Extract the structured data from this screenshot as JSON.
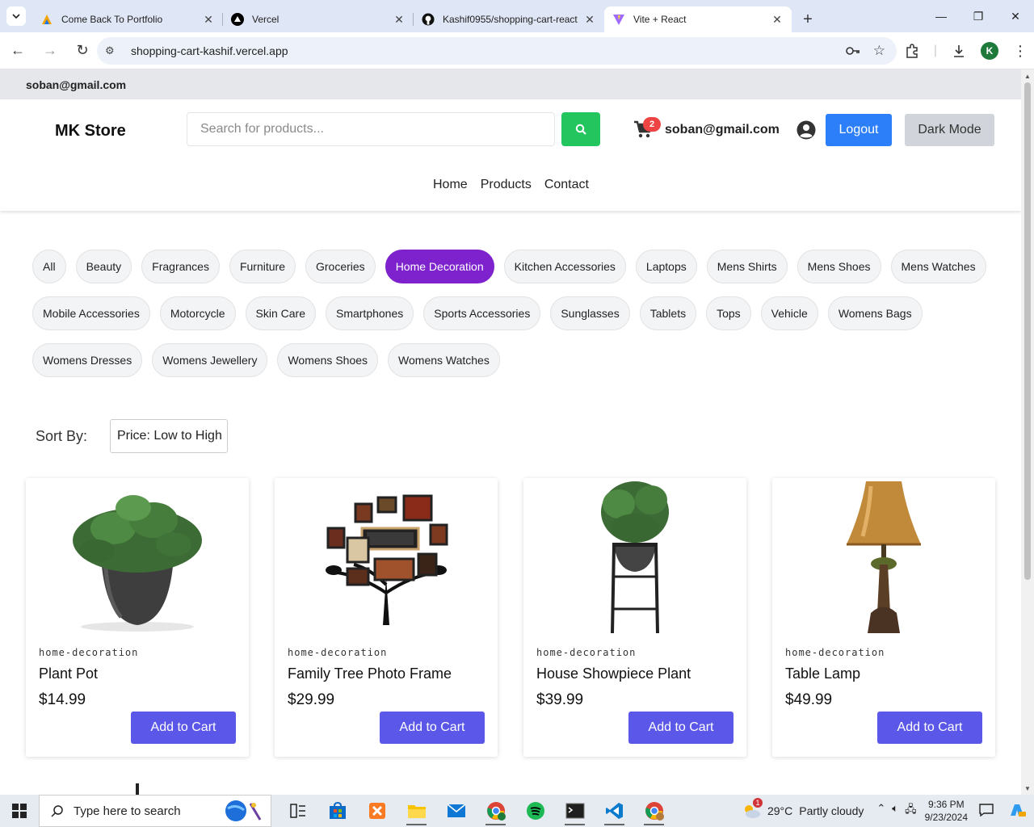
{
  "browser": {
    "tabs": [
      {
        "title": "Come Back To Portfolio",
        "active": false
      },
      {
        "title": "Vercel",
        "active": false
      },
      {
        "title": "Kashif0955/shopping-cart-react",
        "active": false
      },
      {
        "title": "Vite + React",
        "active": true
      }
    ],
    "url": "shopping-cart-kashif.vercel.app",
    "profile_initial": "K"
  },
  "topstrip": {
    "email": "soban@gmail.com"
  },
  "header": {
    "brand": "MK Store",
    "search_placeholder": "Search for products...",
    "cart_count": "2",
    "user_email": "soban@gmail.com",
    "logout_label": "Logout",
    "dark_mode_label": "Dark Mode",
    "accent_search": "#22c55e",
    "accent_logout": "#2d7ff9"
  },
  "nav": {
    "items": [
      "Home",
      "Products",
      "Contact"
    ]
  },
  "categories": {
    "rows": [
      [
        "All",
        "Beauty",
        "Fragrances",
        "Furniture",
        "Groceries",
        "Home Decoration",
        "Kitchen Accessories",
        "Laptops",
        "Mens Shirts",
        "Mens Shoes",
        "Mens Watches"
      ],
      [
        "Mobile Accessories",
        "Motorcycle",
        "Skin Care",
        "Smartphones",
        "Sports Accessories",
        "Sunglasses",
        "Tablets",
        "Tops",
        "Vehicle",
        "Womens Bags"
      ],
      [
        "Womens Dresses",
        "Womens Jewellery",
        "Womens Shoes",
        "Womens Watches"
      ]
    ],
    "active": "Home Decoration",
    "active_color": "#7e22ce"
  },
  "sort": {
    "label": "Sort By:",
    "value": "Price: Low to High"
  },
  "products": [
    {
      "category": "home-decoration",
      "name": "Plant Pot",
      "price": "$14.99",
      "button": "Add to Cart",
      "image_icon": "plant-pot-image"
    },
    {
      "category": "home-decoration",
      "name": "Family Tree Photo Frame",
      "price": "$29.99",
      "button": "Add to Cart",
      "image_icon": "family-tree-frame-image"
    },
    {
      "category": "home-decoration",
      "name": "House Showpiece Plant",
      "price": "$39.99",
      "button": "Add to Cart",
      "image_icon": "showpiece-plant-image"
    },
    {
      "category": "home-decoration",
      "name": "Table Lamp",
      "price": "$49.99",
      "button": "Add to Cart",
      "image_icon": "table-lamp-image"
    }
  ],
  "taskbar": {
    "search_placeholder": "Type here to search",
    "weather_temp": "29°C",
    "weather_desc": "Partly cloudy",
    "weather_badge": "1",
    "time": "9:36 PM",
    "date": "9/23/2024"
  }
}
